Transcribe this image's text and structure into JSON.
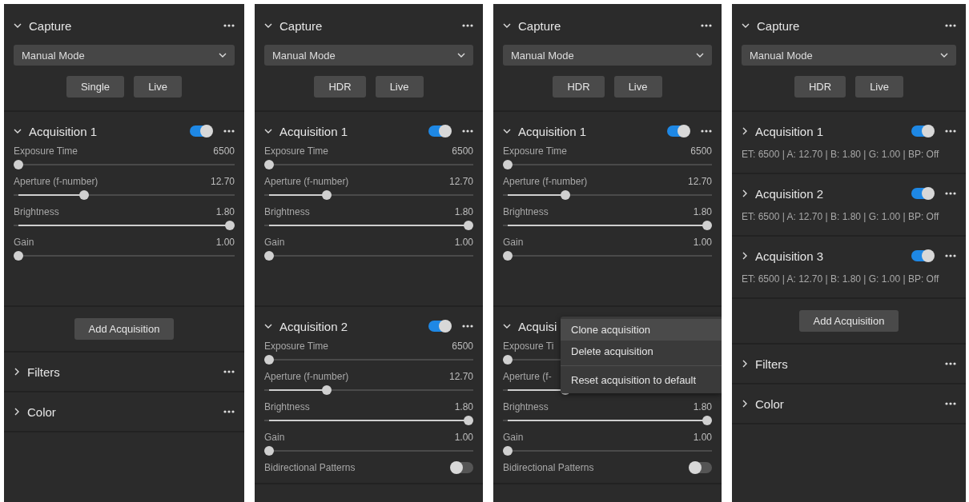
{
  "panels": [
    {
      "sections": [
        {
          "kind": "capture",
          "title": "Capture",
          "expanded": true,
          "mode": "Manual Mode",
          "buttons": [
            "Single",
            "Live"
          ]
        },
        {
          "kind": "acquisition",
          "title": "Acquisition 1",
          "expanded": true,
          "enabled": true,
          "sliders": [
            {
              "label": "Exposure Time",
              "value": "6500",
              "level": 0
            },
            {
              "label": "Aperture (f-number)",
              "value": "12.70",
              "level": 0.31
            },
            {
              "label": "Brightness",
              "value": "1.80",
              "level": 1
            },
            {
              "label": "Gain",
              "value": "1.00",
              "level": 0
            }
          ]
        },
        {
          "kind": "add",
          "button": "Add Acquisition"
        },
        {
          "kind": "group",
          "title": "Filters",
          "expanded": false
        },
        {
          "kind": "group",
          "title": "Color",
          "expanded": false
        }
      ]
    },
    {
      "sections": [
        {
          "kind": "capture",
          "title": "Capture",
          "expanded": true,
          "mode": "Manual Mode",
          "buttons": [
            "HDR",
            "Live"
          ]
        },
        {
          "kind": "acquisition",
          "title": "Acquisition 1",
          "expanded": true,
          "enabled": true,
          "sliders": [
            {
              "label": "Exposure Time",
              "value": "6500",
              "level": 0
            },
            {
              "label": "Aperture (f-number)",
              "value": "12.70",
              "level": 0.29
            },
            {
              "label": "Brightness",
              "value": "1.80",
              "level": 1
            },
            {
              "label": "Gain",
              "value": "1.00",
              "level": 0
            }
          ]
        },
        {
          "kind": "acquisition",
          "title": "Acquisition 2",
          "expanded": true,
          "enabled": true,
          "sliders": [
            {
              "label": "Exposure Time",
              "value": "6500",
              "level": 0
            },
            {
              "label": "Aperture (f-number)",
              "value": "12.70",
              "level": 0.29
            },
            {
              "label": "Brightness",
              "value": "1.80",
              "level": 1
            },
            {
              "label": "Gain",
              "value": "1.00",
              "level": 0
            }
          ],
          "switches": [
            {
              "label": "Bidirectional Patterns",
              "on": false
            }
          ]
        }
      ]
    },
    {
      "sections": [
        {
          "kind": "capture",
          "title": "Capture",
          "expanded": true,
          "mode": "Manual Mode",
          "buttons": [
            "HDR",
            "Live"
          ]
        },
        {
          "kind": "acquisition",
          "title": "Acquisition 1",
          "expanded": true,
          "enabled": true,
          "sliders": [
            {
              "label": "Exposure Time",
              "value": "6500",
              "level": 0
            },
            {
              "label": "Aperture (f-number)",
              "value": "12.70",
              "level": 0.29
            },
            {
              "label": "Brightness",
              "value": "1.80",
              "level": 1
            },
            {
              "label": "Gain",
              "value": "1.00",
              "level": 0
            }
          ]
        },
        {
          "kind": "acquisition",
          "title": "Acquisi",
          "expanded": true,
          "sliders": [
            {
              "label": "Exposure Ti",
              "level": 0
            },
            {
              "label": "Aperture (f-",
              "level": 0.29
            },
            {
              "label": "Brightness",
              "value": "1.80",
              "level": 1
            },
            {
              "label": "Gain",
              "value": "1.00",
              "level": 0
            }
          ],
          "switches": [
            {
              "label": "Bidirectional Patterns",
              "on": false
            }
          ],
          "menu": [
            {
              "label": "Clone acquisition",
              "selected": true,
              "divider_before": false
            },
            {
              "label": "Delete acquisition",
              "selected": false,
              "divider_before": false
            },
            {
              "label": "Reset acquisition to default",
              "selected": false,
              "divider_before": true
            }
          ]
        }
      ]
    },
    {
      "sections": [
        {
          "kind": "capture",
          "title": "Capture",
          "expanded": true,
          "mode": "Manual Mode",
          "buttons": [
            "HDR",
            "Live"
          ]
        },
        {
          "kind": "acquisition",
          "title": "Acquisition 1",
          "expanded": false,
          "enabled": true,
          "summary": "ET: 6500 | A: 12.70 | B: 1.80 | G: 1.00 | BP: Off"
        },
        {
          "kind": "acquisition",
          "title": "Acquisition 2",
          "expanded": false,
          "enabled": true,
          "summary": "ET: 6500 | A: 12.70 | B: 1.80 | G: 1.00 | BP: Off"
        },
        {
          "kind": "acquisition",
          "title": "Acquisition 3",
          "expanded": false,
          "enabled": true,
          "summary": "ET: 6500 | A: 12.70 | B: 1.80 | G: 1.00 | BP: Off"
        },
        {
          "kind": "add",
          "button": "Add Acquisition"
        },
        {
          "kind": "group",
          "title": "Filters",
          "expanded": false
        },
        {
          "kind": "group",
          "title": "Color",
          "expanded": false
        }
      ]
    }
  ]
}
